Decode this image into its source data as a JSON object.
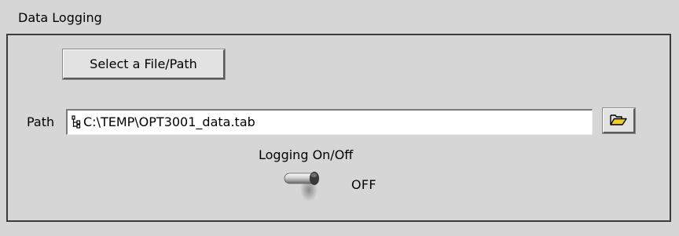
{
  "panel": {
    "title": "Data Logging"
  },
  "file_select": {
    "button_label": "Select a File/Path"
  },
  "path": {
    "label": "Path",
    "value": "C:\\TEMP\\OPT3001_data.tab",
    "icon": "path-icon",
    "browse_icon": "folder-open-icon"
  },
  "logging": {
    "label": "Logging On/Off",
    "state_text": "OFF",
    "is_on": false
  }
}
